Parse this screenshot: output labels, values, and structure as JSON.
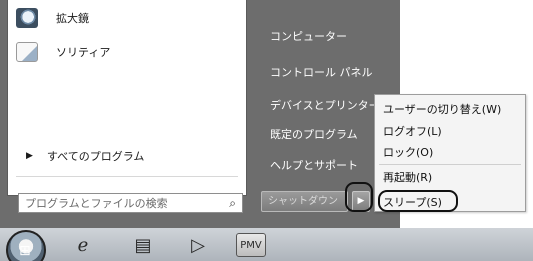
{
  "start_menu": {
    "pinned_programs": [
      {
        "label": "拡大鏡",
        "icon": "magnifier-icon"
      },
      {
        "label": "ソリティア",
        "icon": "solitaire-icon"
      }
    ],
    "all_programs": {
      "arrow": "▶",
      "label": "すべてのプログラム"
    },
    "search": {
      "placeholder": "プログラムとファイルの検索",
      "icon": "search-icon",
      "glyph": "⌕"
    },
    "right_items": [
      "コンピューター",
      "コントロール パネル",
      "デバイスとプリンター",
      "既定のプログラム",
      "ヘルプとサポート"
    ],
    "shutdown": {
      "label": "シャットダウン",
      "arrow": "▶"
    }
  },
  "power_submenu": {
    "items": [
      "ユーザーの切り替え(W)",
      "ログオフ(L)",
      "ロック(O)",
      "再起動(R)",
      "スリープ(S)"
    ]
  },
  "taskbar": {
    "start_glyph": "⊞",
    "icons": [
      {
        "name": "internet-explorer-icon",
        "glyph": "ℯ"
      },
      {
        "name": "windows-explorer-icon",
        "glyph": "▤"
      },
      {
        "name": "media-player-icon",
        "glyph": "▷"
      },
      {
        "name": "app-icon",
        "glyph": "PMV"
      }
    ]
  },
  "colors": {
    "menu_bg": "#6d6d6d",
    "taskbar": "#bcc1c7"
  }
}
